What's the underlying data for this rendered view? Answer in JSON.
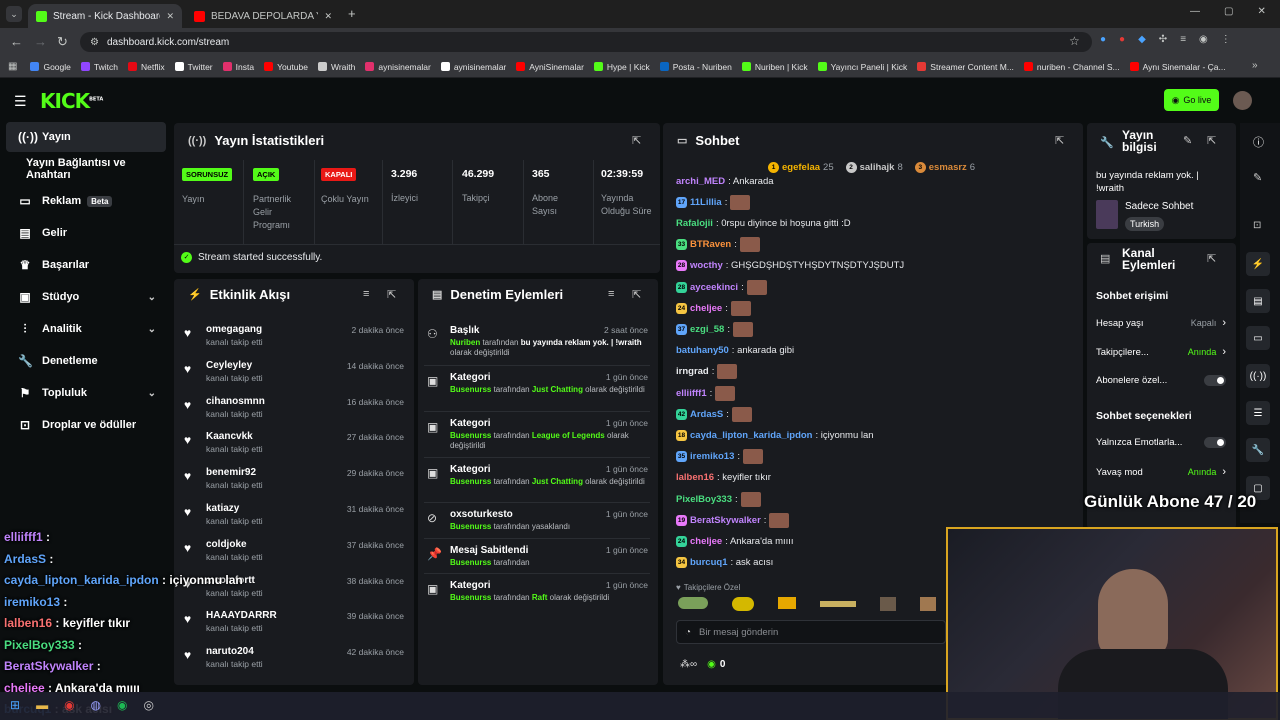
{
  "browser": {
    "tabs": [
      {
        "title": "Stream - Kick Dashboard",
        "favicon_color": "#53fc18",
        "active": true
      },
      {
        "title": "BEDAVA DEPOLARDA YILIN DE",
        "favicon_color": "#ff0000",
        "active": false
      }
    ],
    "url": "dashboard.kick.com/stream",
    "bookmarks": [
      {
        "label": "Google",
        "color": "#4285f4"
      },
      {
        "label": "Twitch",
        "color": "#9146ff"
      },
      {
        "label": "Netflix",
        "color": "#e50914"
      },
      {
        "label": "Twitter",
        "color": "#ffffff"
      },
      {
        "label": "Insta",
        "color": "#e1306c"
      },
      {
        "label": "Youtube",
        "color": "#ff0000"
      },
      {
        "label": "Wraith",
        "color": "#cccccc"
      },
      {
        "label": "aynisinemalar",
        "color": "#e1306c"
      },
      {
        "label": "aynisinemalar",
        "color": "#ffffff"
      },
      {
        "label": "AyniSinemalar",
        "color": "#ff0000"
      },
      {
        "label": "Hype | Kick",
        "color": "#53fc18"
      },
      {
        "label": "Posta - Nuriben",
        "color": "#0a66c2"
      },
      {
        "label": "Nuriben | Kick",
        "color": "#53fc18"
      },
      {
        "label": "Yayıncı Paneli | Kick",
        "color": "#53fc18"
      },
      {
        "label": "Streamer Content M...",
        "color": "#e53935"
      },
      {
        "label": "nuriben - Channel S...",
        "color": "#ff0000"
      },
      {
        "label": "Aynı Sinemalar - Ça...",
        "color": "#ff0000"
      }
    ]
  },
  "header": {
    "logo": "KICK",
    "logo_sup": "BETA",
    "golive": "Go live"
  },
  "sidebar": [
    {
      "label": "Yayın",
      "icon": "signal-icon"
    },
    {
      "label": "Yayın Bağlantısı ve Anahtarı",
      "icon": ""
    },
    {
      "label": "Reklam",
      "icon": "ad-icon",
      "badge": "Beta"
    },
    {
      "label": "Gelir",
      "icon": "chart-icon"
    },
    {
      "label": "Başarılar",
      "icon": "trophy-icon"
    },
    {
      "label": "Stüdyo",
      "icon": "studio-icon"
    },
    {
      "label": "Analitik",
      "icon": "analytics-icon"
    },
    {
      "label": "Denetleme",
      "icon": "wrench-icon"
    },
    {
      "label": "Topluluk",
      "icon": "community-icon"
    },
    {
      "label": "Droplar ve ödüller",
      "icon": "gift-icon"
    }
  ],
  "stats": {
    "title": "Yayın İstatistikleri",
    "cols": [
      {
        "badge": "SORUNSUZ",
        "badge_color": "#53fc18",
        "label": "Yayın"
      },
      {
        "badge": "AÇIK",
        "badge_color": "#53fc18",
        "label": "Partnerlik Gelir Programı"
      },
      {
        "badge": "KAPALI",
        "badge_color": "#e91916",
        "label": "Çoklu Yayın"
      },
      {
        "value": "3.296",
        "label": "İzleyici"
      },
      {
        "value": "46.299",
        "label": "Takipçi"
      },
      {
        "value": "365",
        "label": "Abone Sayısı"
      },
      {
        "value": "02:39:59",
        "label": "Yayında Olduğu Süre"
      }
    ],
    "success": "Stream started successfully."
  },
  "activity": {
    "title": "Etkinlik Akışı",
    "items": [
      {
        "name": "omegagang",
        "sub": "kanalı takip etti",
        "time": "2 dakika önce"
      },
      {
        "name": "Ceyleyley",
        "sub": "kanalı takip etti",
        "time": "14 dakika önce"
      },
      {
        "name": "cihanosmnn",
        "sub": "kanalı takip etti",
        "time": "16 dakika önce"
      },
      {
        "name": "Kaancvkk",
        "sub": "kanalı takip etti",
        "time": "27 dakika önce"
      },
      {
        "name": "benemir92",
        "sub": "kanalı takip etti",
        "time": "29 dakika önce"
      },
      {
        "name": "katiazy",
        "sub": "kanalı takip etti",
        "time": "31 dakika önce"
      },
      {
        "name": "coldjoke",
        "sub": "kanalı takip etti",
        "time": "37 dakika önce"
      },
      {
        "name": "...comfortt",
        "sub": "kanalı takip etti",
        "time": "38 dakika önce"
      },
      {
        "name": "HAAAYDARRR",
        "sub": "kanalı takip etti",
        "time": "39 dakika önce"
      },
      {
        "name": "naruto204",
        "sub": "kanalı takip etti",
        "time": "42 dakika önce"
      }
    ]
  },
  "moderation": {
    "title": "Denetim Eylemleri",
    "items": [
      {
        "title": "Başlık",
        "time": "2 saat önce",
        "who": "Nuriben",
        "mid": " tarafından ",
        "val": "bu yayında reklam yok. | !wraith",
        "rest": " olarak değiştirildi"
      },
      {
        "title": "Kategori",
        "time": "1 gün önce",
        "who": "Busenurss",
        "mid": " tarafından ",
        "val": "Just Chatting",
        "rest": " olarak değiştirildi"
      },
      {
        "title": "Kategori",
        "time": "1 gün önce",
        "who": "Busenurss",
        "mid": " tarafından ",
        "val": "League of Legends",
        "rest": " olarak değiştirildi"
      },
      {
        "title": "Kategori",
        "time": "1 gün önce",
        "who": "Busenurss",
        "mid": " tarafından ",
        "val": "Just Chatting",
        "rest": " olarak değiştirildi"
      },
      {
        "title": "oxsoturkesto",
        "time": "1 gün önce",
        "who": "Busenurss",
        "mid": " tarafından yasaklandı",
        "val": "",
        "rest": ""
      },
      {
        "title": "Mesaj Sabitlendi",
        "time": "1 gün önce",
        "who": "Busenurss",
        "mid": " tarafından",
        "val": "",
        "rest": ""
      },
      {
        "title": "Kategori",
        "time": "1 gün önce",
        "who": "Busenurss",
        "mid": " tarafından ",
        "val": "Raft",
        "rest": "  olarak değiştirildi"
      }
    ]
  },
  "chat": {
    "title": "Sohbet",
    "top_gifters": [
      {
        "rank": "1",
        "name": "egefelaa",
        "count": "25",
        "color": "#f5b400"
      },
      {
        "rank": "2",
        "name": "salihajk",
        "count": "8",
        "color": "#c8c8c8"
      },
      {
        "rank": "3",
        "name": "esmasrz",
        "count": "6",
        "color": "#d98a3a"
      }
    ],
    "messages": [
      {
        "lvl": "",
        "user": "archi_MED",
        "color": "#c084fc",
        "text": ": Ankarada",
        "emote": false
      },
      {
        "lvl": "17",
        "user": "11Lillia",
        "color": "#60a5fa",
        "text": ":",
        "emote": true
      },
      {
        "lvl": "",
        "user": "Rafalojii",
        "color": "#4ade80",
        "text": ": 0rspu diyince bi hoşuna gitti :D",
        "emote": false
      },
      {
        "lvl": "33",
        "user": "BTRaven",
        "color": "#fb923c",
        "text": ":",
        "emote": true
      },
      {
        "lvl": "28",
        "user": "wocthy",
        "color": "#c084fc",
        "text": ": GHŞGDŞHDŞTYHŞDYTNŞDTYJŞDUTJ",
        "emote": false
      },
      {
        "lvl": "28",
        "user": "ayceekinci",
        "color": "#c084fc",
        "text": ":",
        "emote": true
      },
      {
        "lvl": "24",
        "user": "cheljee",
        "color": "#e879f9",
        "text": ":",
        "emote": true
      },
      {
        "lvl": "37",
        "user": "ezgi_58",
        "color": "#4ade80",
        "text": ":",
        "emote": true
      },
      {
        "lvl": "",
        "user": "batuhany50",
        "color": "#60a5fa",
        "text": ": ankarada gibi",
        "emote": false
      },
      {
        "lvl": "",
        "user": "irngrad",
        "color": "#e8eaed",
        "text": ":",
        "emote": true
      },
      {
        "lvl": "",
        "user": "elliifff1",
        "color": "#c084fc",
        "text": ":",
        "emote": true
      },
      {
        "lvl": "42",
        "user": "ArdasS",
        "color": "#60a5fa",
        "text": ":",
        "emote": true
      },
      {
        "lvl": "18",
        "user": "cayda_lipton_karida_ipdon",
        "color": "#60a5fa",
        "text": ": içiyonmu lan",
        "emote": false
      },
      {
        "lvl": "35",
        "user": "iremiko13",
        "color": "#60a5fa",
        "text": ":",
        "emote": true
      },
      {
        "lvl": "",
        "user": "lalben16",
        "color": "#f87171",
        "text": ": keyifler tıkır",
        "emote": false
      },
      {
        "lvl": "",
        "user": "PixelBoy333",
        "color": "#4ade80",
        "text": ":",
        "emote": true
      },
      {
        "lvl": "19",
        "user": "BeratSkywalker",
        "color": "#c084fc",
        "text": ":",
        "emote": true
      },
      {
        "lvl": "24",
        "user": "cheljee",
        "color": "#e879f9",
        "text": ": Ankara'da mıııı",
        "emote": false
      },
      {
        "lvl": "34",
        "user": "burcuq1",
        "color": "#60a5fa",
        "text": ": ask acısı",
        "emote": false
      }
    ],
    "followers_only": "Takipçilere Özel",
    "placeholder": "Bir mesaj gönderin",
    "points": "0"
  },
  "info": {
    "title": "Yayın bilgisi",
    "stream_title": "bu yayında reklam yok. | !wraith",
    "category": "Sadece Sohbet",
    "tag": "Turkish"
  },
  "channel": {
    "title": "Kanal Eylemleri",
    "access_heading": "Sohbet erişimi",
    "rows": [
      {
        "label": "Hesap yaşı",
        "value": "Kapalı",
        "type": "link"
      },
      {
        "label": "Takipçilere...",
        "value": "Anında",
        "type": "link"
      },
      {
        "label": "Abonelere özel...",
        "value": "",
        "type": "toggle"
      }
    ],
    "options_heading": "Sohbet seçenekleri",
    "options": [
      {
        "label": "Yalnızca Emotlarla...",
        "value": "",
        "type": "toggle"
      },
      {
        "label": "Yavaş mod",
        "value": "Anında",
        "type": "link"
      }
    ]
  },
  "overlay": {
    "goal": "Günlük Abone 47 / 20",
    "chat": [
      {
        "user": "elliifff1",
        "color": "#c084fc",
        "text": " :"
      },
      {
        "user": "ArdasS",
        "color": "#60a5fa",
        "text": " :"
      },
      {
        "user": "cayda_lipton_karida_ipdon",
        "color": "#60a5fa",
        "text": " : içiyonmu lan"
      },
      {
        "user": "iremiko13",
        "color": "#60a5fa",
        "text": " :"
      },
      {
        "user": "lalben16",
        "color": "#f87171",
        "text": " : keyifler tıkır"
      },
      {
        "user": "PixelBoy333",
        "color": "#4ade80",
        "text": " :"
      },
      {
        "user": "BeratSkywalker",
        "color": "#c084fc",
        "text": " :"
      },
      {
        "user": "cheljee",
        "color": "#e879f9",
        "text": " : Ankara'da mıııı"
      },
      {
        "user": "burcuq1",
        "color": "#60a5fa",
        "text": " : ask acısı"
      }
    ]
  }
}
